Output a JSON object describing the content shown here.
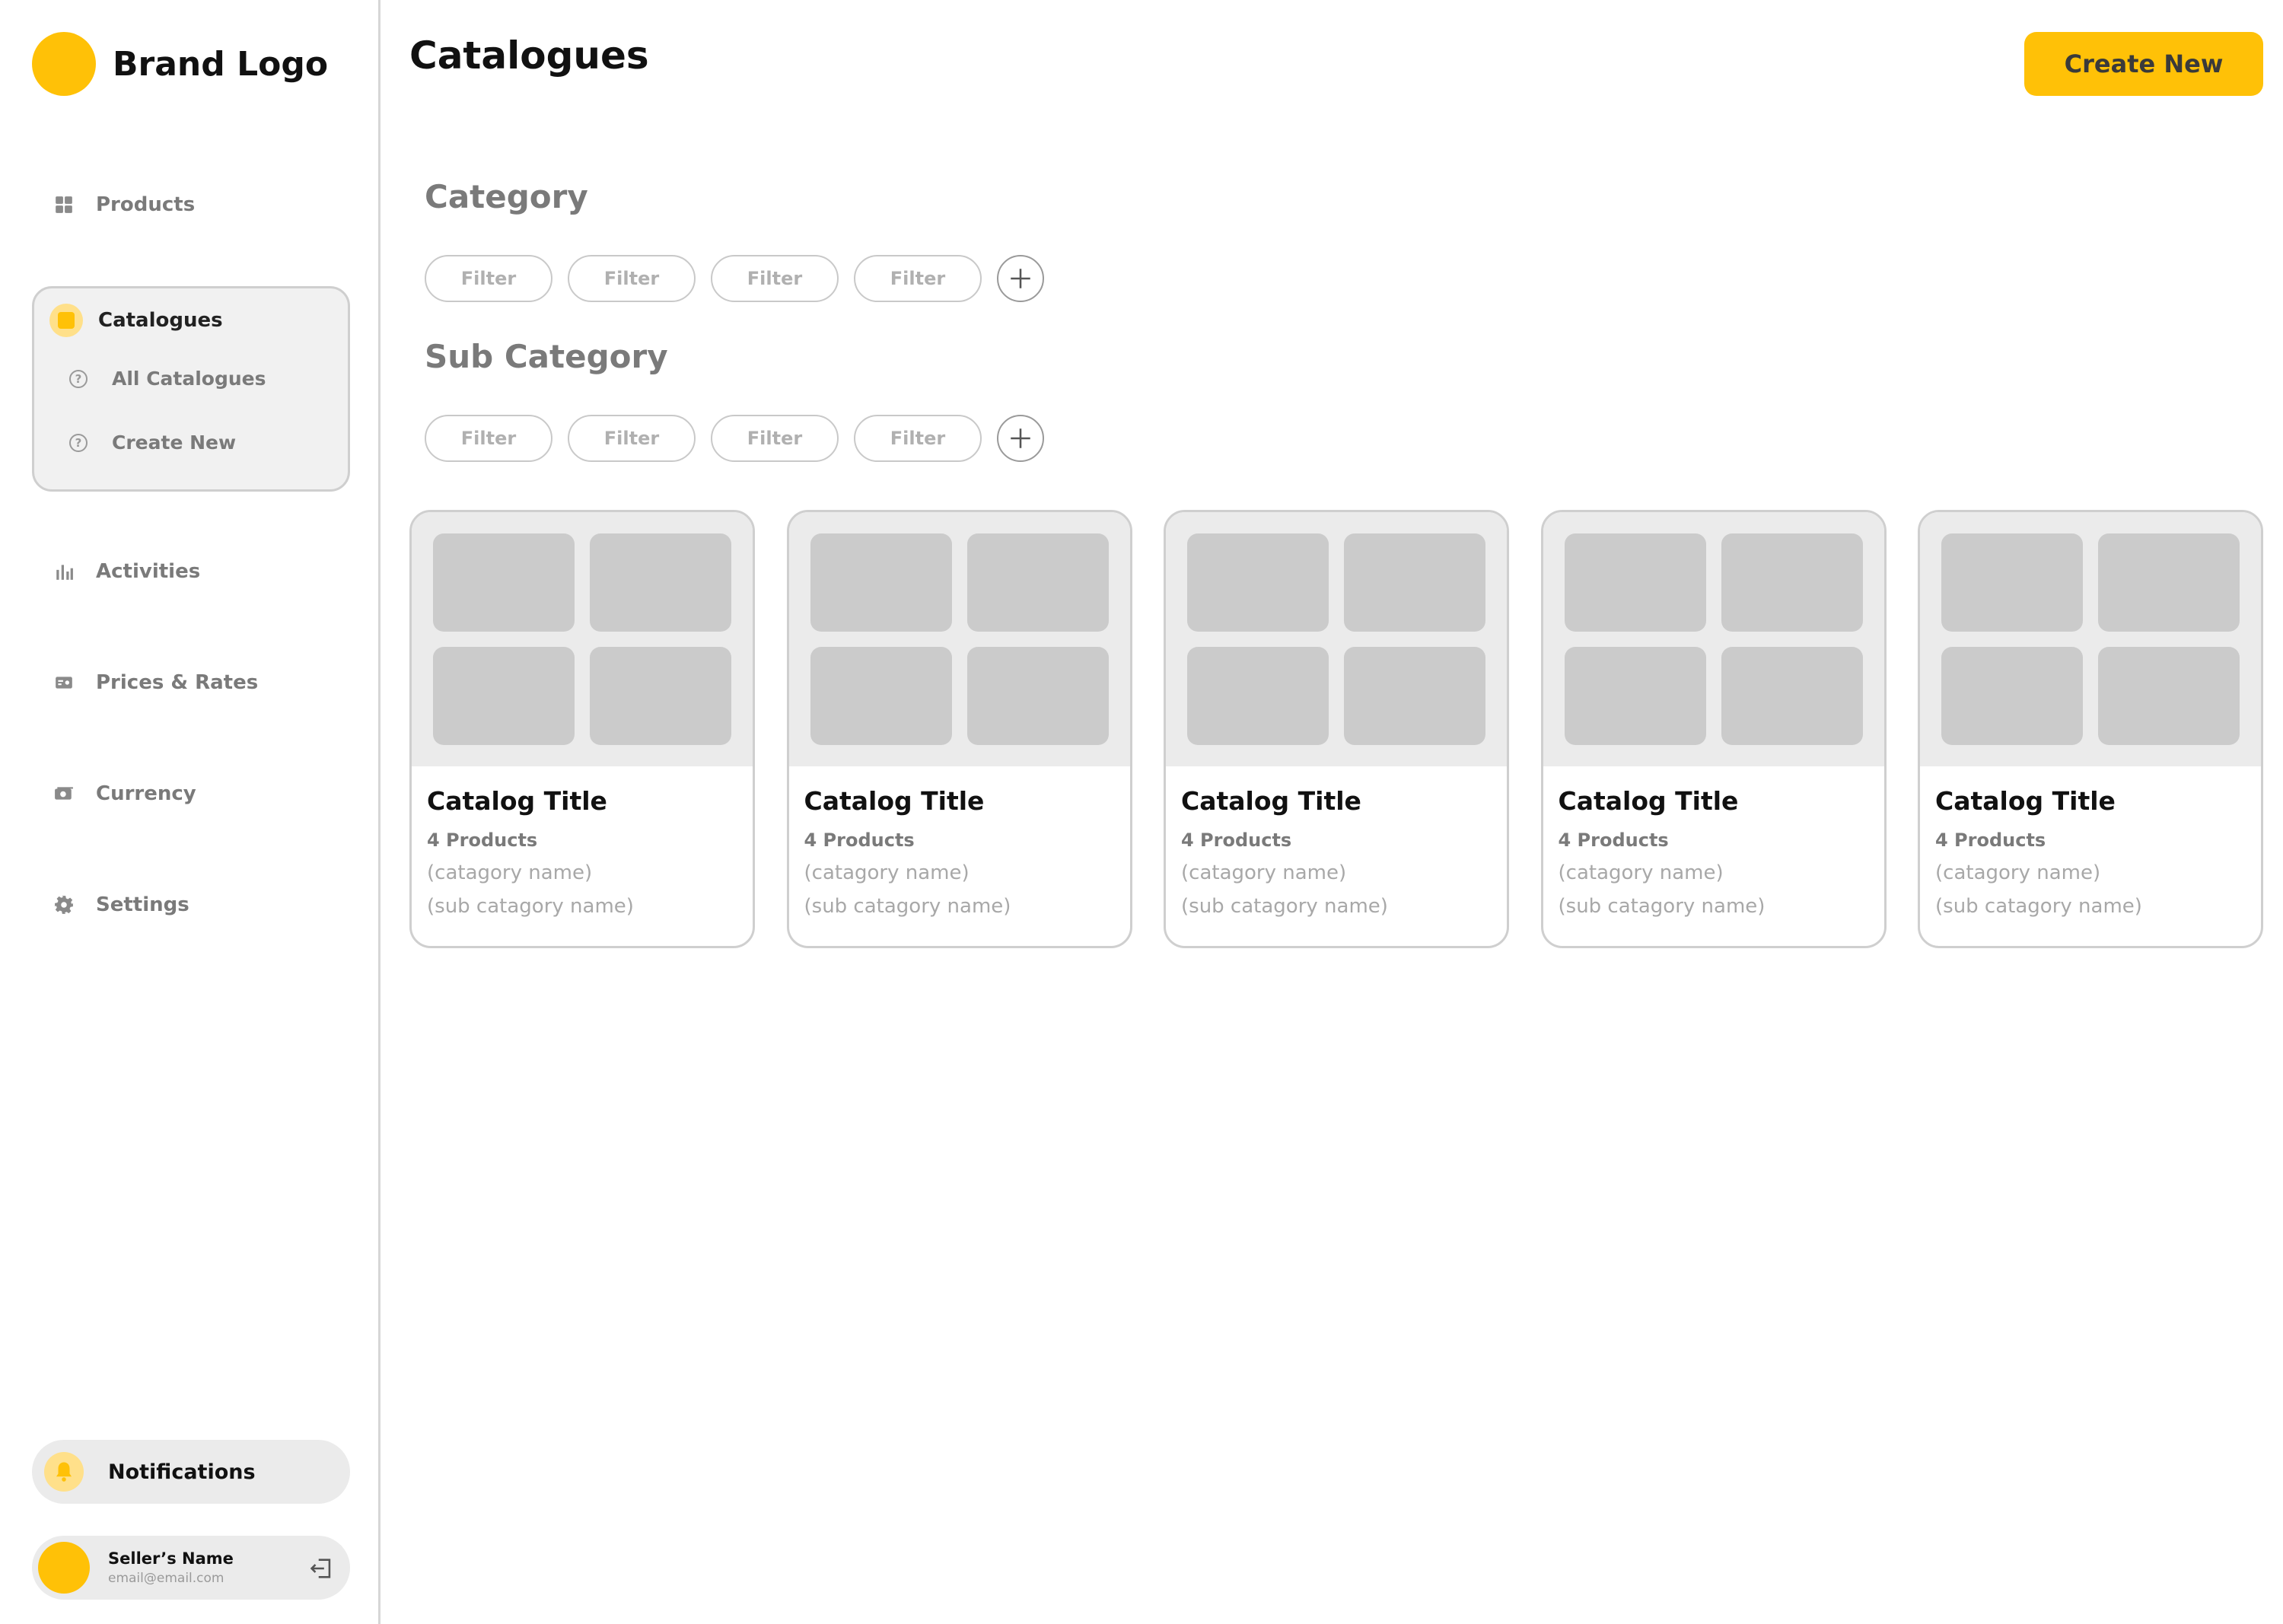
{
  "brand": {
    "name": "Brand Logo",
    "accent": "#FFC107"
  },
  "sidebar": {
    "items": [
      {
        "label": "Products",
        "icon": "grid-icon"
      },
      {
        "label": "Catalogues",
        "icon": "book-icon"
      },
      {
        "label": "Activities",
        "icon": "bar-chart-icon"
      },
      {
        "label": "Prices & Rates",
        "icon": "price-tag-icon"
      },
      {
        "label": "Currency",
        "icon": "cash-icon"
      },
      {
        "label": "Settings",
        "icon": "gear-icon"
      }
    ],
    "catalogues_sub": [
      {
        "label": "All Catalogues",
        "icon": "help-circle-icon"
      },
      {
        "label": "Create New",
        "icon": "help-circle-icon"
      }
    ],
    "notifications_label": "Notifications",
    "seller": {
      "name": "Seller’s Name",
      "email": "email@email.com"
    }
  },
  "header": {
    "title": "Catalogues",
    "create_label": "Create New"
  },
  "filters": {
    "category_title": "Category",
    "subcategory_title": "Sub Category",
    "category_chips": [
      "Filter",
      "Filter",
      "Filter",
      "Filter"
    ],
    "subcategory_chips": [
      "Filter",
      "Filter",
      "Filter",
      "Filter"
    ]
  },
  "cards": [
    {
      "title": "Catalog Title",
      "count": "4 Products",
      "category": "(catagory name)",
      "subcategory": "(sub catagory name)"
    },
    {
      "title": "Catalog Title",
      "count": "4 Products",
      "category": "(catagory name)",
      "subcategory": "(sub catagory name)"
    },
    {
      "title": "Catalog Title",
      "count": "4 Products",
      "category": "(catagory name)",
      "subcategory": "(sub catagory name)"
    },
    {
      "title": "Catalog Title",
      "count": "4 Products",
      "category": "(catagory name)",
      "subcategory": "(sub catagory name)"
    },
    {
      "title": "Catalog Title",
      "count": "4 Products",
      "category": "(catagory name)",
      "subcategory": "(sub catagory name)"
    }
  ]
}
